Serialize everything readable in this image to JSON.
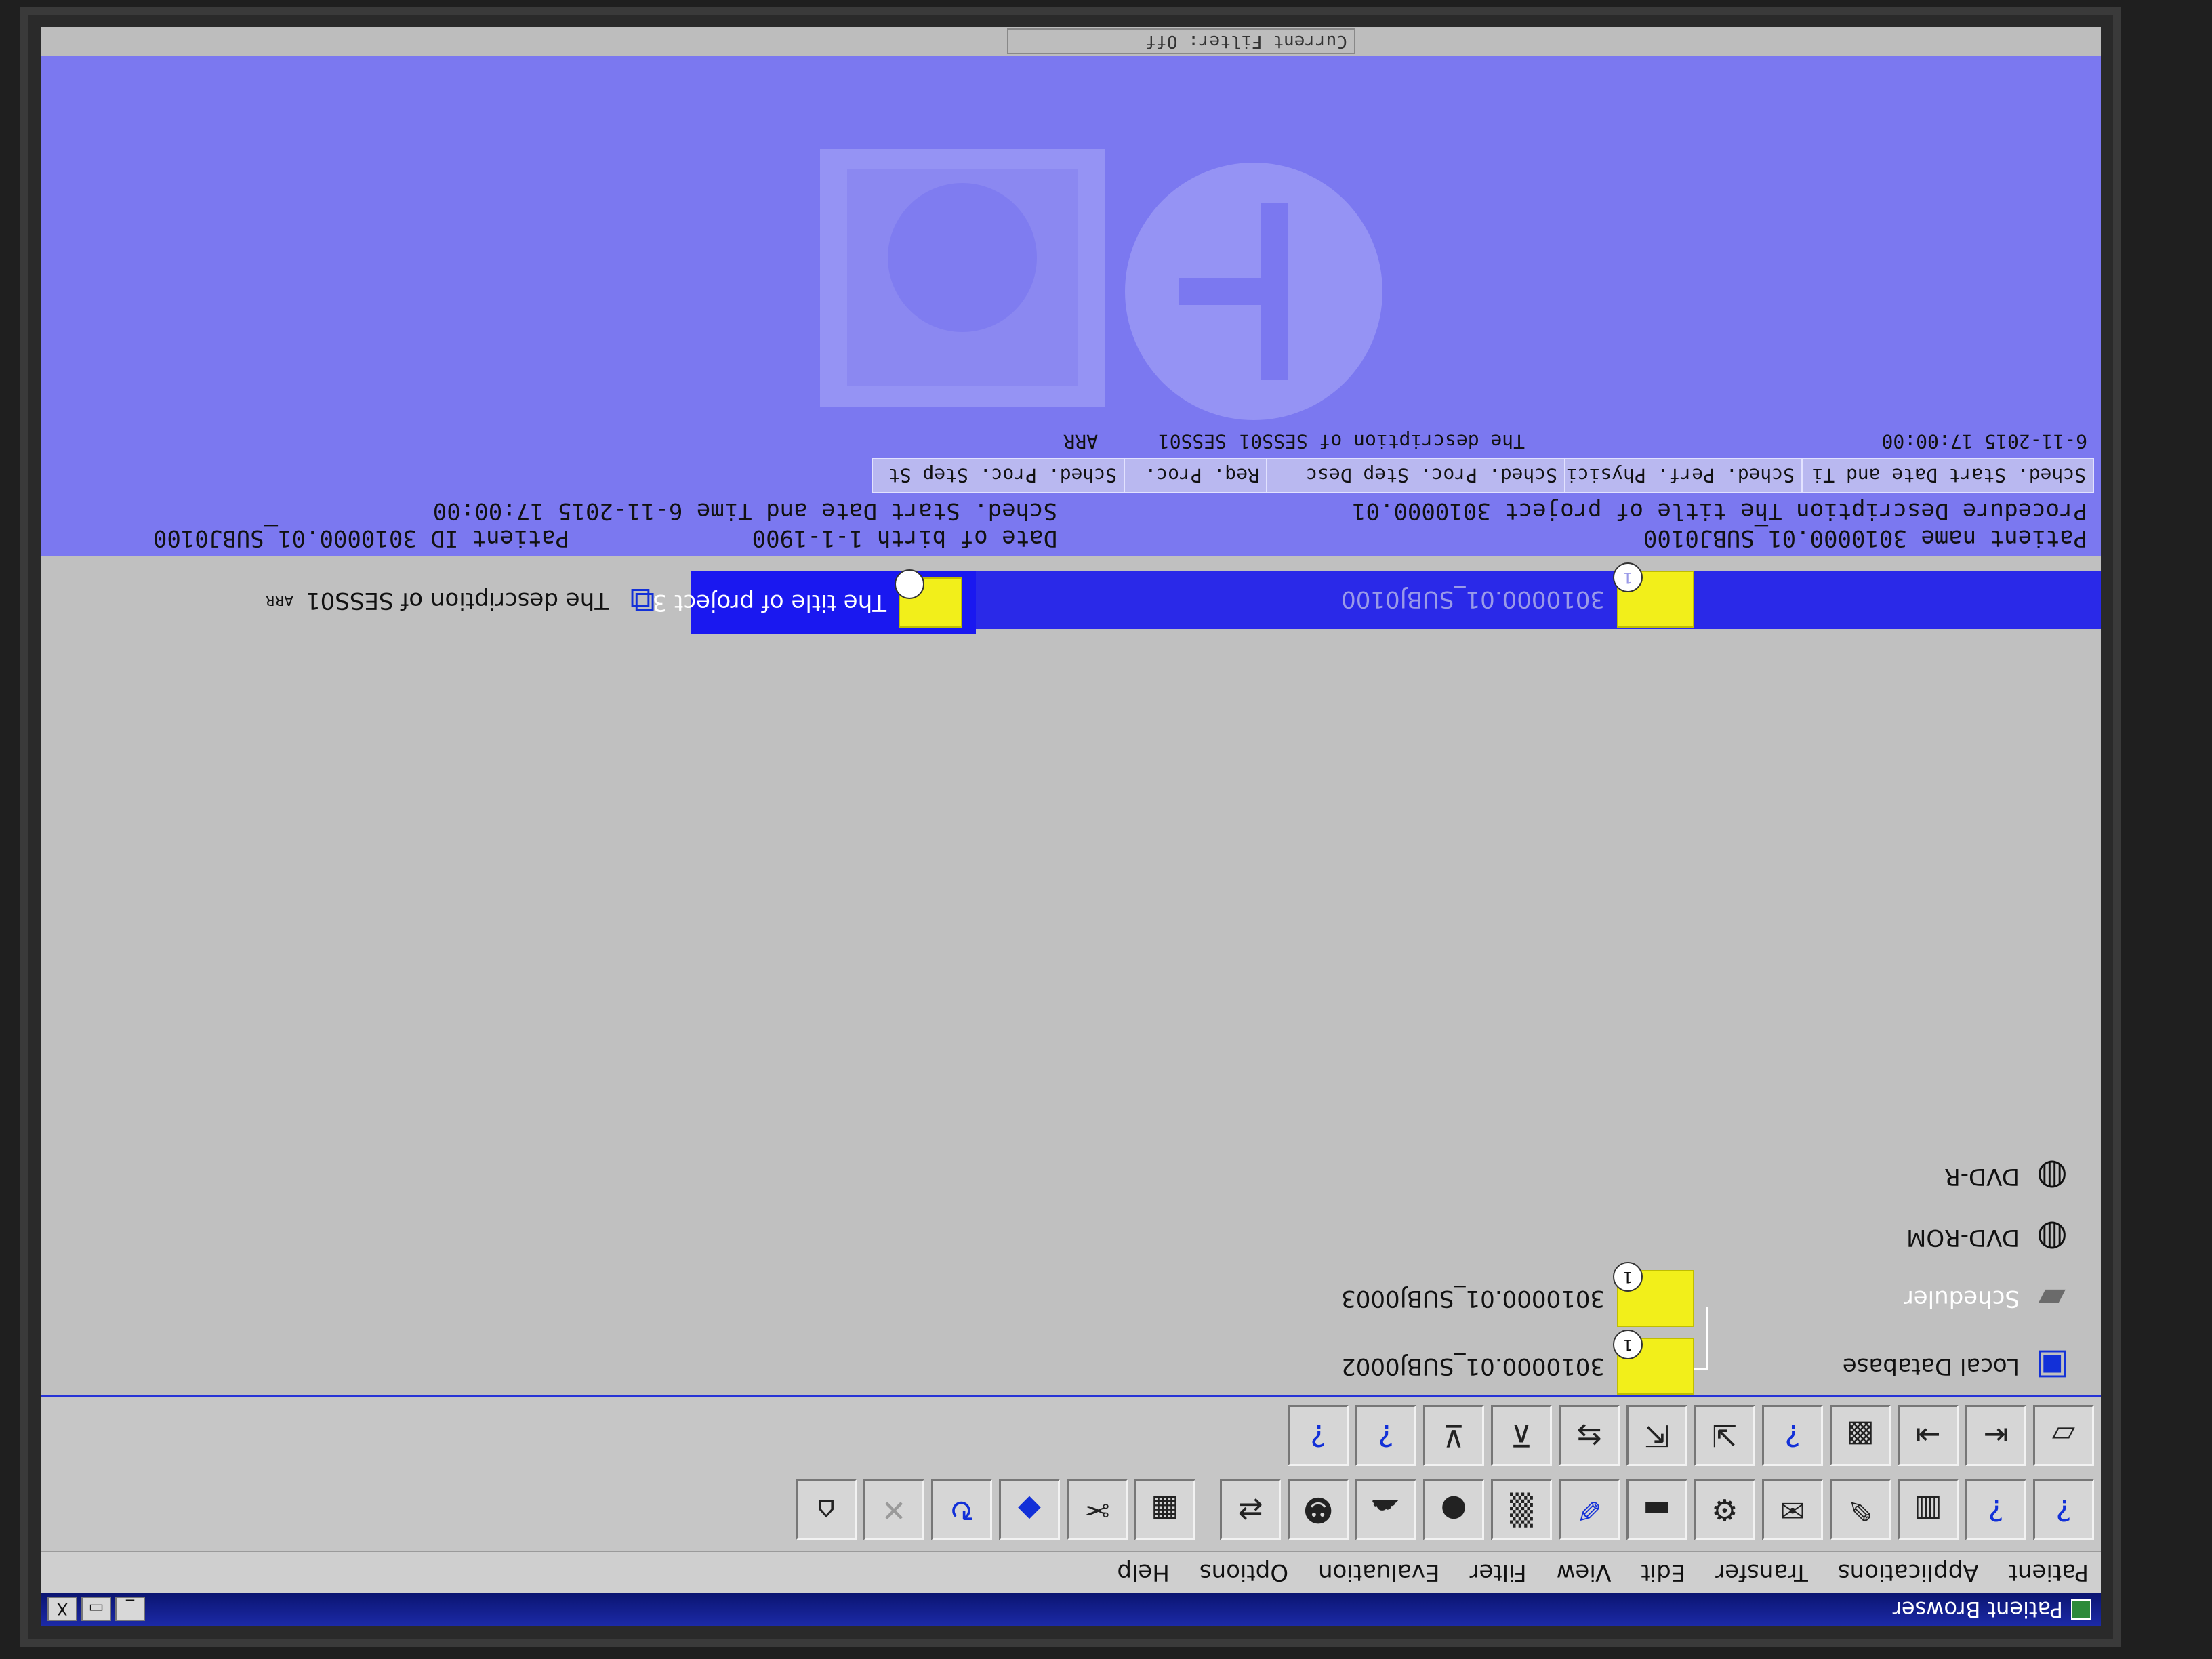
{
  "window": {
    "title": "Patient Browser",
    "controls": [
      "_",
      "▭",
      "X"
    ]
  },
  "menu": [
    "Patient",
    "Applications",
    "Transfer",
    "Edit",
    "View",
    "Filter",
    "Evaluation",
    "Options",
    "Help"
  ],
  "toolbar_icons_row1": [
    "help-query-icon",
    "help-query-2-icon",
    "split-view-icon",
    "edit-icon",
    "send-icon",
    "tool-icon",
    "bar-icon",
    "draw-icon",
    "noise-icon",
    "circle-icon",
    "brain-icon",
    "head-icon",
    "switch-icon",
    "grid-icon",
    "scissors-icon",
    "flip-icon",
    "refresh-icon",
    "close-x-icon",
    "delete-icon"
  ],
  "toolbar_icons_row2": [
    "folder-icon",
    "send-left-icon",
    "export-icon",
    "grid-view-icon",
    "query-node-icon",
    "import-icon",
    "move-icon",
    "transfer-icon",
    "cut-icon",
    "archive-icon",
    "query-info-icon",
    "list-query-icon"
  ],
  "tree": {
    "databases": [
      {
        "label": "Local Database"
      },
      {
        "label": "Scheduler"
      },
      {
        "label": "DVD-ROM"
      },
      {
        "label": "DVD-R"
      }
    ],
    "patients": [
      {
        "label": "3010000.01_SUBJ0002"
      },
      {
        "label": "3010000.01_SUBJ0003"
      },
      {
        "label": "3010000.01_SUBJ0100"
      }
    ],
    "study": {
      "label": "The title of project 3"
    },
    "series": {
      "label": "The description of SESS01",
      "tag": "ARR"
    }
  },
  "info": {
    "patient_name_label": "Patient name",
    "patient_name": "3010000.01_SUBJ0100",
    "dob_label": "Date of birth",
    "dob": "1-1-1900",
    "patient_id_label": "Patient ID",
    "patient_id": "3010000.01_SUBJ0100",
    "proc_desc_label": "Procedure Description",
    "proc_desc": "The title of project 3010000.01",
    "sched_label": "Sched. Start Date and Time",
    "sched": "6-11-2015 17:00:00",
    "columns": [
      "Sched. Start Date and Ti",
      "Sched. Perf. Physici",
      "Sched. Proc. Step Desc",
      "Req. Proc.",
      "Sched. Proc. Step St"
    ],
    "row": [
      "6-11-2015 17:00:00",
      "",
      "The description of SESS01",
      "SESS01",
      "ARR"
    ],
    "filter": "Current Filter: Off"
  }
}
